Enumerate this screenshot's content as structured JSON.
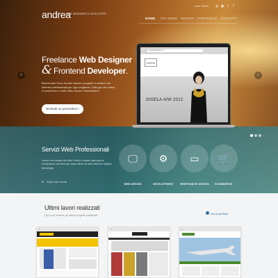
{
  "header": {
    "logo": "andrea",
    "logo_tagline": "WEB DESIGNER & DEVELOPER",
    "client_area": "Area Clienti",
    "social": [
      "camera-icon",
      "dribbble-icon",
      "twitter-icon",
      "facebook-icon"
    ],
    "social_glyphs": [
      "◎",
      "◉",
      "t",
      "f"
    ],
    "nav": [
      "HOME",
      "CHI SONO",
      "SERVIZI",
      "PORTFOLIO",
      "CONTATTI"
    ]
  },
  "hero": {
    "line1_a": "Freelance ",
    "line1_b": "Web Designer",
    "amp": "&",
    "line2_a": "Frontend ",
    "line2_b": "Developer",
    "line2_c": ".",
    "paragraph": "Benvenuto! Sono Andrea Sacchi, progetto e realizzo siti internet professionali per ogni esigenza. Sviluppo siti online, e-commerce e molto altro ancora. Interessato?",
    "cta": "Richiedi un preventivo",
    "cta_arrow": "›",
    "prev": "‹",
    "next": "›"
  },
  "laptop_preview": {
    "url": "www.chiaprojects.it",
    "shop_logo": "CHIOU",
    "headline": "GISELA A/W 2012"
  },
  "services": {
    "title": "Servizi Web Professionali",
    "paragraph": "Lavoro nel campo da oltre 5 anni e seguo ogni giorno l'evoluzione del web per poter offrire ai miei clienti le migliori tecnologie.",
    "location_pin": "●",
    "location": "Scopri tutti i servizi",
    "items": [
      {
        "label": "WEB DESIGN",
        "icon": "monitor-icon",
        "glyph": "🖵"
      },
      {
        "label": "DEVELOPMENT",
        "icon": "gears-icon",
        "glyph": "⚙"
      },
      {
        "label": "RESPONSIVE DESIGN",
        "icon": "devices-icon",
        "glyph": "▭"
      },
      {
        "label": "ECOMMERCE",
        "icon": "cart-icon",
        "glyph": "🛒"
      }
    ]
  },
  "latest": {
    "title": "Ultimi lavori realizzati",
    "subtitle": "Qui puoi vedere gli ultimi progetti pubblicati.",
    "link": "Vai al portfolio"
  }
}
